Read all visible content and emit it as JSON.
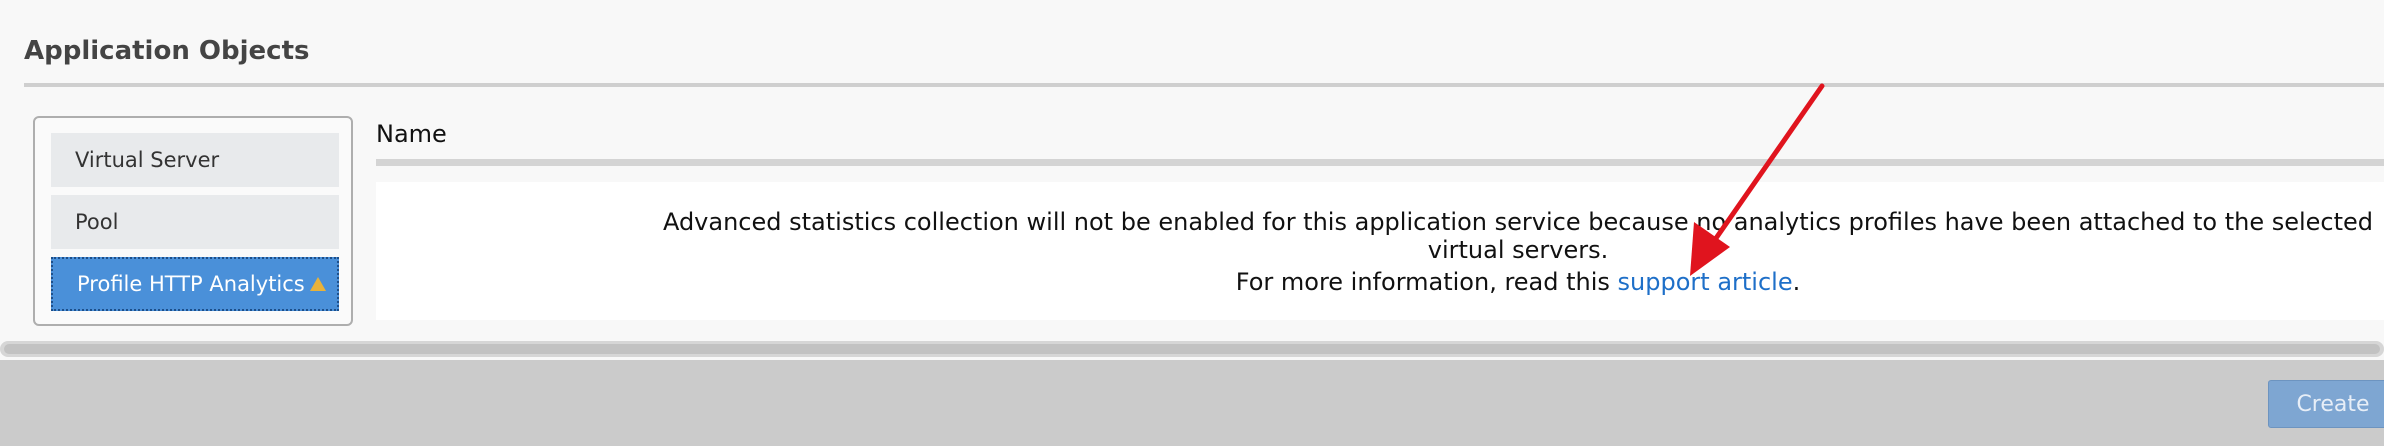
{
  "section": {
    "title": "Application Objects"
  },
  "objects": {
    "items": [
      {
        "label": "Virtual Server"
      },
      {
        "label": "Pool"
      },
      {
        "label": "Profile HTTP Analytics",
        "warning_icon": "warning-triangle-icon"
      }
    ],
    "selected_index": 2
  },
  "table": {
    "column_header": "Name"
  },
  "message": {
    "line1": "Advanced statistics collection will not be enabled for this application service because no analytics profiles have been attached to the selected virtual servers.",
    "line2_prefix": "For more information, read this ",
    "link_text": "support article",
    "line2_suffix": "."
  },
  "footer": {
    "create_label": "Create"
  },
  "colors": {
    "selected_item": "#4a90d9",
    "link": "#1e6fc8",
    "warning": "#e8b23a",
    "annotation_arrow": "#e0141e",
    "create_button": "#7ea6d2"
  }
}
